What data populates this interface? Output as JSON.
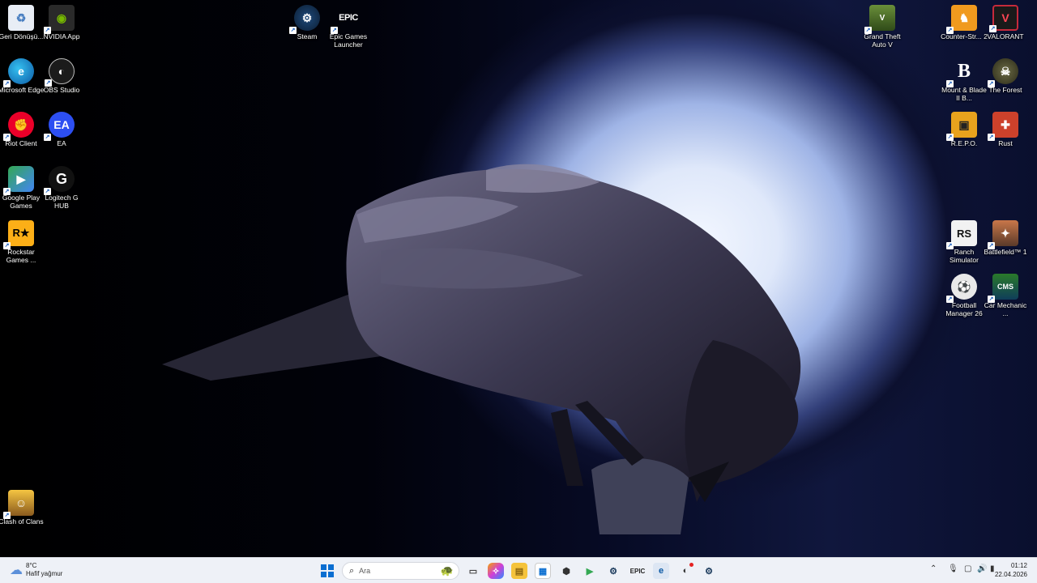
{
  "desktop": {
    "icons": [
      {
        "label": "Geri Dönüşü...",
        "icon": "recycle-bin-icon"
      },
      {
        "label": "NVIDIA App",
        "icon": "nvidia-icon"
      },
      {
        "label": "Microsoft Edge",
        "icon": "edge-icon"
      },
      {
        "label": "OBS Studio",
        "icon": "obs-icon"
      },
      {
        "label": "Riot Client",
        "icon": "riot-icon"
      },
      {
        "label": "EA",
        "icon": "ea-icon"
      },
      {
        "label": "Google Play Games",
        "icon": "google-play-games-icon"
      },
      {
        "label": "Logitech G HUB",
        "icon": "logitech-icon"
      },
      {
        "label": "Rockstar Games ...",
        "icon": "rockstar-icon"
      },
      {
        "label": "Clash of Clans",
        "icon": "clash-of-clans-icon"
      },
      {
        "label": "Steam",
        "icon": "steam-icon"
      },
      {
        "label": "Epic Games Launcher",
        "icon": "epic-games-icon"
      },
      {
        "label": "Grand Theft Auto V",
        "icon": "gta-icon"
      },
      {
        "label": "Counter-Str... 2",
        "icon": "counter-strike-icon"
      },
      {
        "label": "VALORANT",
        "icon": "valorant-icon"
      },
      {
        "label": "Mount & Blade II B...",
        "icon": "bannerlord-icon"
      },
      {
        "label": "The Forest",
        "icon": "the-forest-icon"
      },
      {
        "label": "R.E.P.O.",
        "icon": "repo-icon"
      },
      {
        "label": "Rust",
        "icon": "rust-icon"
      },
      {
        "label": "Ranch Simulator",
        "icon": "ranch-simulator-icon"
      },
      {
        "label": "Battlefield™ 1",
        "icon": "battlefield-icon"
      },
      {
        "label": "Football Manager 26",
        "icon": "football-manager-icon"
      },
      {
        "label": "Car Mechanic ...",
        "icon": "car-mechanic-icon"
      }
    ],
    "glyphs": {
      "epic": "EPIC",
      "ea": "EA",
      "logitech": "G",
      "rockstar": "R★",
      "bannerlord": "B",
      "rust": "✚"
    }
  },
  "taskbar": {
    "weather_temp": "8°C",
    "weather_desc": "Hafif yağmur",
    "search_placeholder": "Ara",
    "time": "01:12",
    "date": "22.04.2026",
    "pinned": [
      "start-icon",
      "task-view-icon",
      "copilot-icon",
      "file-explorer-icon",
      "store-icon",
      "unity-icon",
      "google-play-games-icon",
      "steam-icon",
      "epic-games-icon",
      "edge-icon",
      "obs-icon",
      "steam-icon"
    ],
    "tray": [
      "chevron-up-icon",
      "microphone-icon",
      "network-icon",
      "volume-icon",
      "battery-icon"
    ]
  }
}
